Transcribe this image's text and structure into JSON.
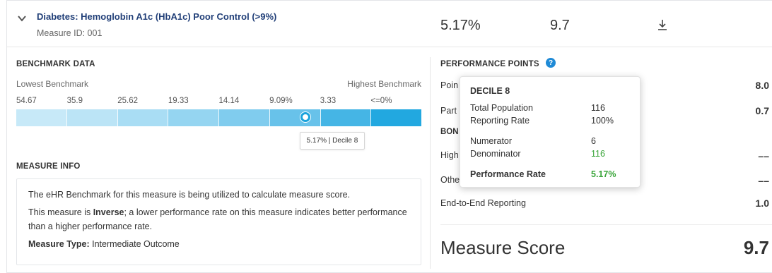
{
  "header": {
    "title": "Diabetes: Hemoglobin A1c (HbA1c) Poor Control (>9%)",
    "measure_id": "Measure ID: 001",
    "rate": "5.17%",
    "score": "9.7",
    "icons": [
      "chevron-down-icon",
      "download-icon"
    ]
  },
  "benchmark": {
    "section_title": "BENCHMARK DATA",
    "lowest_label": "Lowest Benchmark",
    "highest_label": "Highest Benchmark",
    "ticks": [
      "54.67",
      "35.9",
      "25.62",
      "19.33",
      "14.14",
      "9.09%",
      "3.33",
      "<=0%"
    ],
    "segment_colors": [
      "#c7e9f8",
      "#bbe4f6",
      "#a9ddf4",
      "#95d5f1",
      "#80ccee",
      "#68c2ea",
      "#45b5e5",
      "#22a8e0"
    ],
    "marker_label": "5.17% | Decile 8"
  },
  "measure_info": {
    "section_title": "MEASURE INFO",
    "line1": "The eHR Benchmark for this measure is being utilized to calculate measure score.",
    "line2_prefix": "This measure is ",
    "line2_bold": "Inverse",
    "line2_suffix": "; a lower performance rate on this measure indicates better performance than a higher performance rate.",
    "type_label": "Measure Type:",
    "type_value": "Intermediate Outcome"
  },
  "performance": {
    "section_title": "PERFORMANCE POINTS",
    "rows": [
      {
        "label": "Poin",
        "value": "8.0"
      },
      {
        "label": "Part",
        "value": "0.7"
      },
      {
        "label": "BON",
        "value": ""
      },
      {
        "label": "High",
        "value": "––"
      },
      {
        "label": "Othe",
        "value": "––"
      },
      {
        "label": "End-to-End Reporting",
        "value": "1.0"
      }
    ],
    "score_label": "Measure Score",
    "score_value": "9.7"
  },
  "popup": {
    "title": "DECILE 8",
    "total_population_label": "Total Population",
    "total_population_value": "116",
    "reporting_rate_label": "Reporting Rate",
    "reporting_rate_value": "100%",
    "numerator_label": "Numerator",
    "numerator_value": "6",
    "denominator_label": "Denominator",
    "denominator_value": "116",
    "performance_rate_label": "Performance Rate",
    "performance_rate_value": "5.17%"
  },
  "colors": {
    "title_blue": "#213f78",
    "accent_blue": "#1aa3dc",
    "help_blue": "#1f8ad6",
    "green": "#3aa53a"
  }
}
